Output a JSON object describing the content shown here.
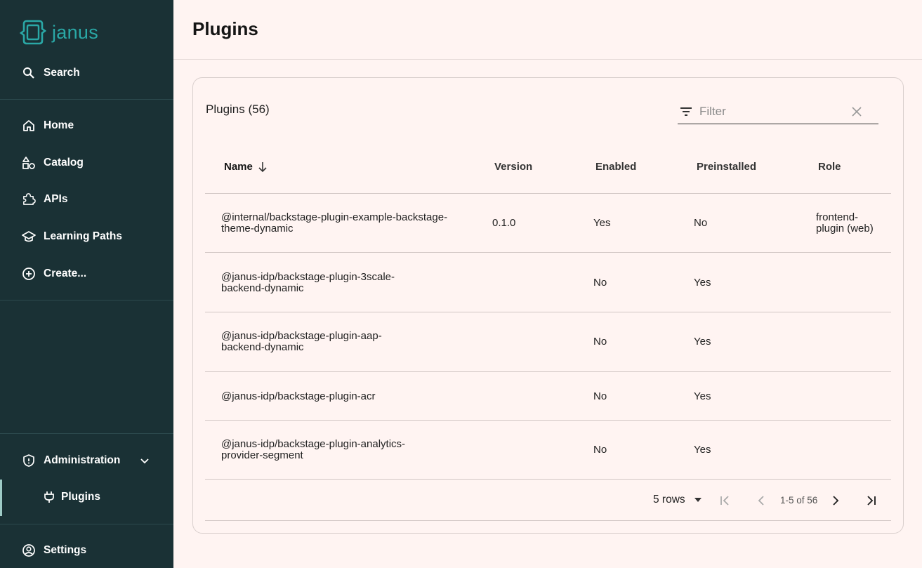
{
  "app": {
    "logo_text": "janus"
  },
  "sidebar": {
    "search_label": "Search",
    "items": [
      {
        "label": "Home",
        "icon": "home-icon"
      },
      {
        "label": "Catalog",
        "icon": "catalog-icon"
      },
      {
        "label": "APIs",
        "icon": "puzzle-icon"
      },
      {
        "label": "Learning Paths",
        "icon": "school-icon"
      },
      {
        "label": "Create...",
        "icon": "add-circle-icon"
      }
    ],
    "admin_label": "Administration",
    "plugins_label": "Plugins",
    "settings_label": "Settings"
  },
  "header": {
    "title": "Plugins"
  },
  "table": {
    "title": "Plugins (56)",
    "filter_placeholder": "Filter",
    "columns": [
      "Name",
      "Version",
      "Enabled",
      "Preinstalled",
      "Role"
    ],
    "sort_column": "Name",
    "rows": [
      {
        "name": "@internal/backstage-plugin-example-backstage-theme-dynamic",
        "version": "0.1.0",
        "enabled": "Yes",
        "preinstalled": "No",
        "role": "frontend-plugin (web)"
      },
      {
        "name": "@janus-idp/backstage-plugin-3scale-backend-dynamic",
        "version": "",
        "enabled": "No",
        "preinstalled": "Yes",
        "role": ""
      },
      {
        "name": "@janus-idp/backstage-plugin-aap-backend-dynamic",
        "version": "",
        "enabled": "No",
        "preinstalled": "Yes",
        "role": ""
      },
      {
        "name": "@janus-idp/backstage-plugin-acr",
        "version": "",
        "enabled": "No",
        "preinstalled": "Yes",
        "role": ""
      },
      {
        "name": "@janus-idp/backstage-plugin-analytics-provider-segment",
        "version": "",
        "enabled": "No",
        "preinstalled": "Yes",
        "role": ""
      }
    ]
  },
  "pagination": {
    "rows_per_page": "5 rows",
    "range": "1-5 of 56"
  },
  "colors": {
    "sidebar_bg": "#1a3135",
    "accent": "#2aa8a6",
    "page_bg": "#fff4f2"
  }
}
